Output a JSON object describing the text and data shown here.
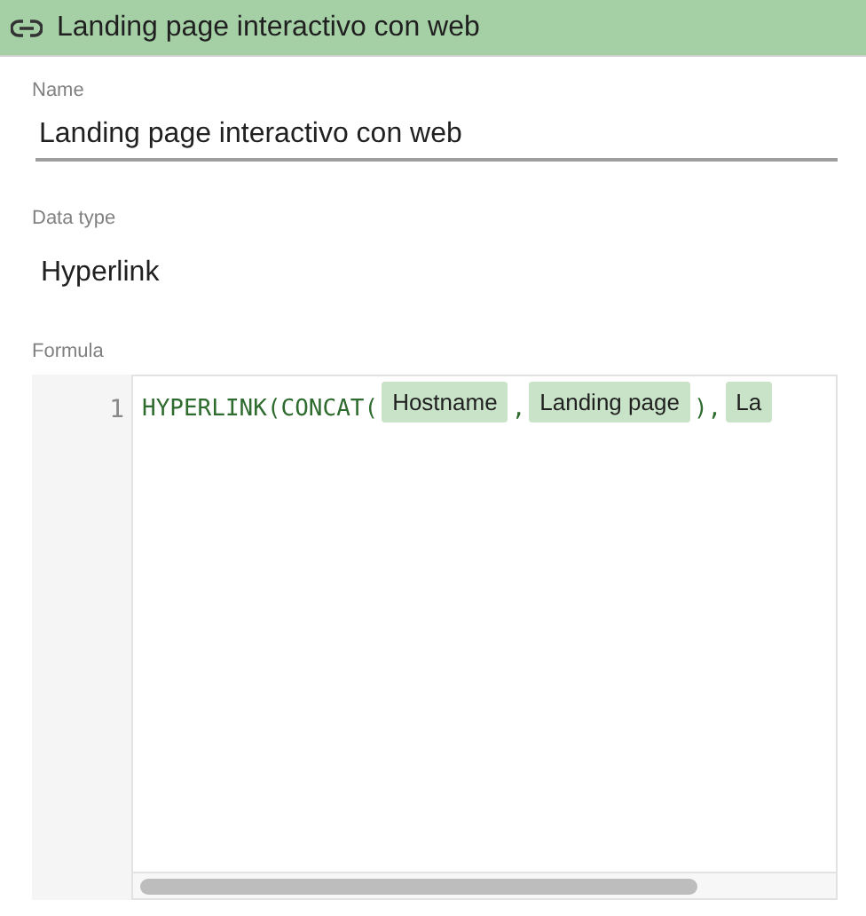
{
  "header": {
    "title": "Landing page interactivo con web"
  },
  "name_field": {
    "label": "Name",
    "value": "Landing page interactivo con web"
  },
  "data_type": {
    "label": "Data type",
    "value": "Hyperlink"
  },
  "formula": {
    "label": "Formula",
    "line_number": "1",
    "tokens": [
      {
        "kind": "code",
        "text": "HYPERLINK(CONCAT("
      },
      {
        "kind": "field",
        "text": "Hostname"
      },
      {
        "kind": "code",
        "text": ","
      },
      {
        "kind": "field",
        "text": "Landing page"
      },
      {
        "kind": "code",
        "text": "),"
      },
      {
        "kind": "field",
        "text": "La"
      }
    ]
  }
}
